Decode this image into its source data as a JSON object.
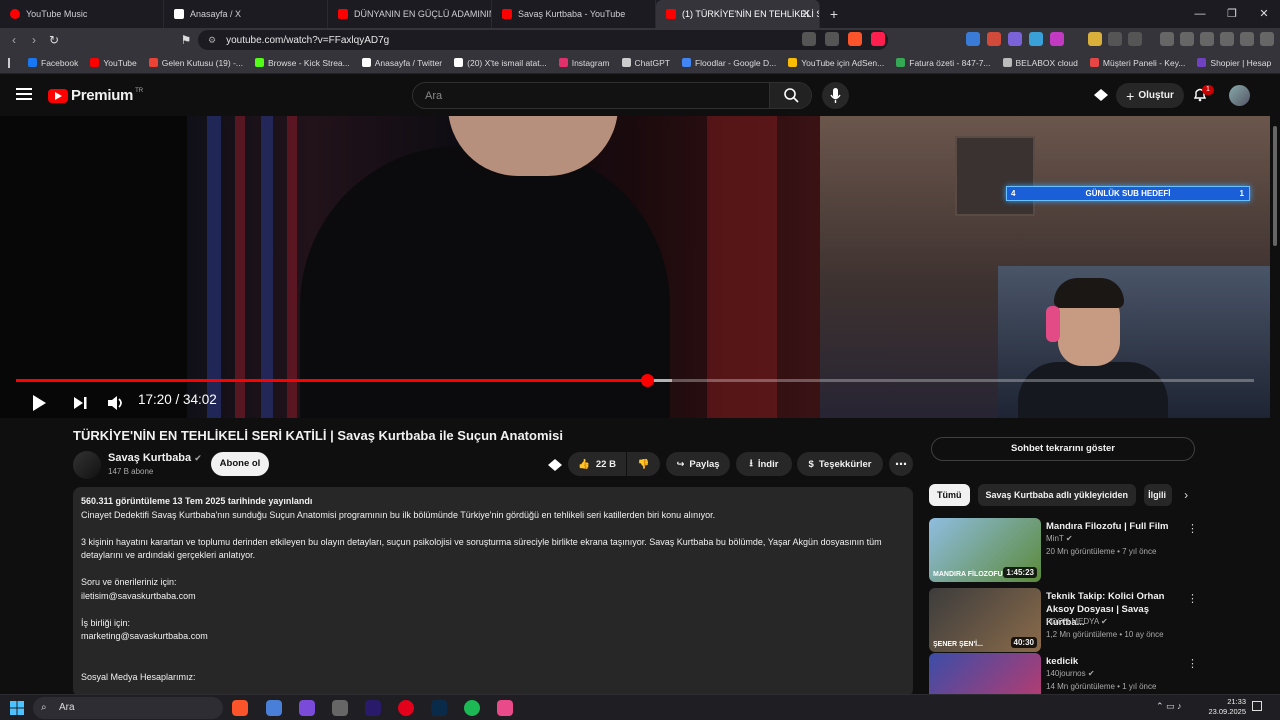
{
  "browser": {
    "tabs": [
      {
        "label": "YouTube Music",
        "color": "#ff0000",
        "active": false
      },
      {
        "label": "Anasayfa / X",
        "color": "#ffffff",
        "active": false
      },
      {
        "label": "DÜNYANIN EN GÜÇLÜ ADAMININ A",
        "color": "#ff0000",
        "active": false
      },
      {
        "label": "Savaş Kurtbaba - YouTube",
        "color": "#ff0000",
        "active": false
      },
      {
        "label": "(1) TÜRKİYE'NİN EN TEHLİKELİ SE",
        "color": "#ff0000",
        "active": true
      }
    ],
    "url": "youtube.com/watch?v=FFaxlqyAD7g",
    "bookmarks": [
      {
        "label": "Facebook",
        "color": "#1877f2"
      },
      {
        "label": "YouTube",
        "color": "#ff0000"
      },
      {
        "label": "Gelen Kutusu (19) -...",
        "color": "#ea4335"
      },
      {
        "label": "Browse - Kick Strea...",
        "color": "#53fc18"
      },
      {
        "label": "Anasayfa / Twitter",
        "color": "#ffffff"
      },
      {
        "label": "(20) X'te ismail atat...",
        "color": "#ffffff"
      },
      {
        "label": "Instagram",
        "color": "#e1306c"
      },
      {
        "label": "ChatGPT",
        "color": "#cccccc"
      },
      {
        "label": "Floodlar - Google D...",
        "color": "#4285f4"
      },
      {
        "label": "YouTube için AdSen...",
        "color": "#fbbc04"
      },
      {
        "label": "Fatura özeti - 847-7...",
        "color": "#34a853"
      },
      {
        "label": "BELABOX cloud",
        "color": "#bbbbbb"
      },
      {
        "label": "Müşteri Paneli - Key...",
        "color": "#e84545"
      },
      {
        "label": "Shopier | Hesap",
        "color": "#6f42c1"
      }
    ]
  },
  "youtube": {
    "logo": "Premium",
    "region": "TR",
    "search_placeholder": "Ara",
    "create_label": "Oluştur",
    "notif_count": "1"
  },
  "player": {
    "overlay_title": "GÜNLÜK SUB HEDEFİ",
    "overlay_left": "4",
    "overlay_right": "1",
    "time": "17:20 / 34:02",
    "progress": 0.51,
    "buffered": 0.53
  },
  "video": {
    "title": "TÜRKİYE'NİN EN TEHLİKELİ SERİ KATİLİ | Savaş Kurtbaba ile Suçun Anatomisi",
    "channel": "Savaş Kurtbaba",
    "subscribers": "147 B abone",
    "subscribe_label": "Abone ol",
    "likes": "22 B",
    "share_label": "Paylaş",
    "download_label": "İndir",
    "thanks_label": "Teşekkürler",
    "desc_header": "560.311 görüntüleme  13 Tem 2025 tarihinde yayınlandı",
    "desc_lines": [
      "Cinayet Dedektifi Savaş Kurtbaba'nın sunduğu Suçun Anatomisi programının bu ilk bölümünde Türkiye'nin gördüğü en tehlikeli seri katillerden biri konu alınıyor.",
      "",
      "3 kişinin hayatını karartan ve toplumu derinden etkileyen bu olayın detayları, suçun psikolojisi ve soruşturma süreciyle birlikte ekrana taşınıyor. Savaş Kurtbaba bu bölümde, Yaşar Akgün dosyasının tüm detaylarını ve ardındaki gerçekleri anlatıyor.",
      "",
      "Soru ve önerileriniz için:",
      "iletisim@savaskurtbaba.com",
      "",
      "İş birliği için:",
      "marketing@savaskurtbaba.com",
      "",
      "",
      "Sosyal Medya Hesaplarımız:"
    ]
  },
  "sidebar": {
    "chat_label": "Sohbet tekrarını göster",
    "chips": [
      "Tümü",
      "Savaş Kurtbaba adlı yükleyiciden",
      "İlgili"
    ],
    "recs": [
      {
        "title": "Mandıra Filozofu | Full Film",
        "channel": "MinT",
        "meta": "20 Mn görüntüleme • 7 yıl önce",
        "duration": "1:45:23",
        "thumb_text": "MANDIRA FİLOZOFU",
        "colorA": "#8fbde0",
        "colorB": "#5c8a3a"
      },
      {
        "title": "Teknik Takip: Kolici Orhan Aksoy Dosyası | Savaş Kurtba...",
        "channel": "FOON MEDYA",
        "meta": "1,2 Mn görüntüleme • 10 ay önce",
        "duration": "40:30",
        "thumb_text": "ŞENER ŞEN'İ...",
        "colorA": "#3c3c3c",
        "colorB": "#8a6b4a"
      },
      {
        "title": "kedicik",
        "channel": "140journos",
        "meta": "14 Mn görüntüleme • 1 yıl önce",
        "duration": "",
        "thumb_text": "",
        "colorA": "#3b4da8",
        "colorB": "#c23a6b"
      }
    ]
  },
  "taskbar": {
    "search": "Ara",
    "time": "21:33",
    "date": "23.09.2025"
  }
}
